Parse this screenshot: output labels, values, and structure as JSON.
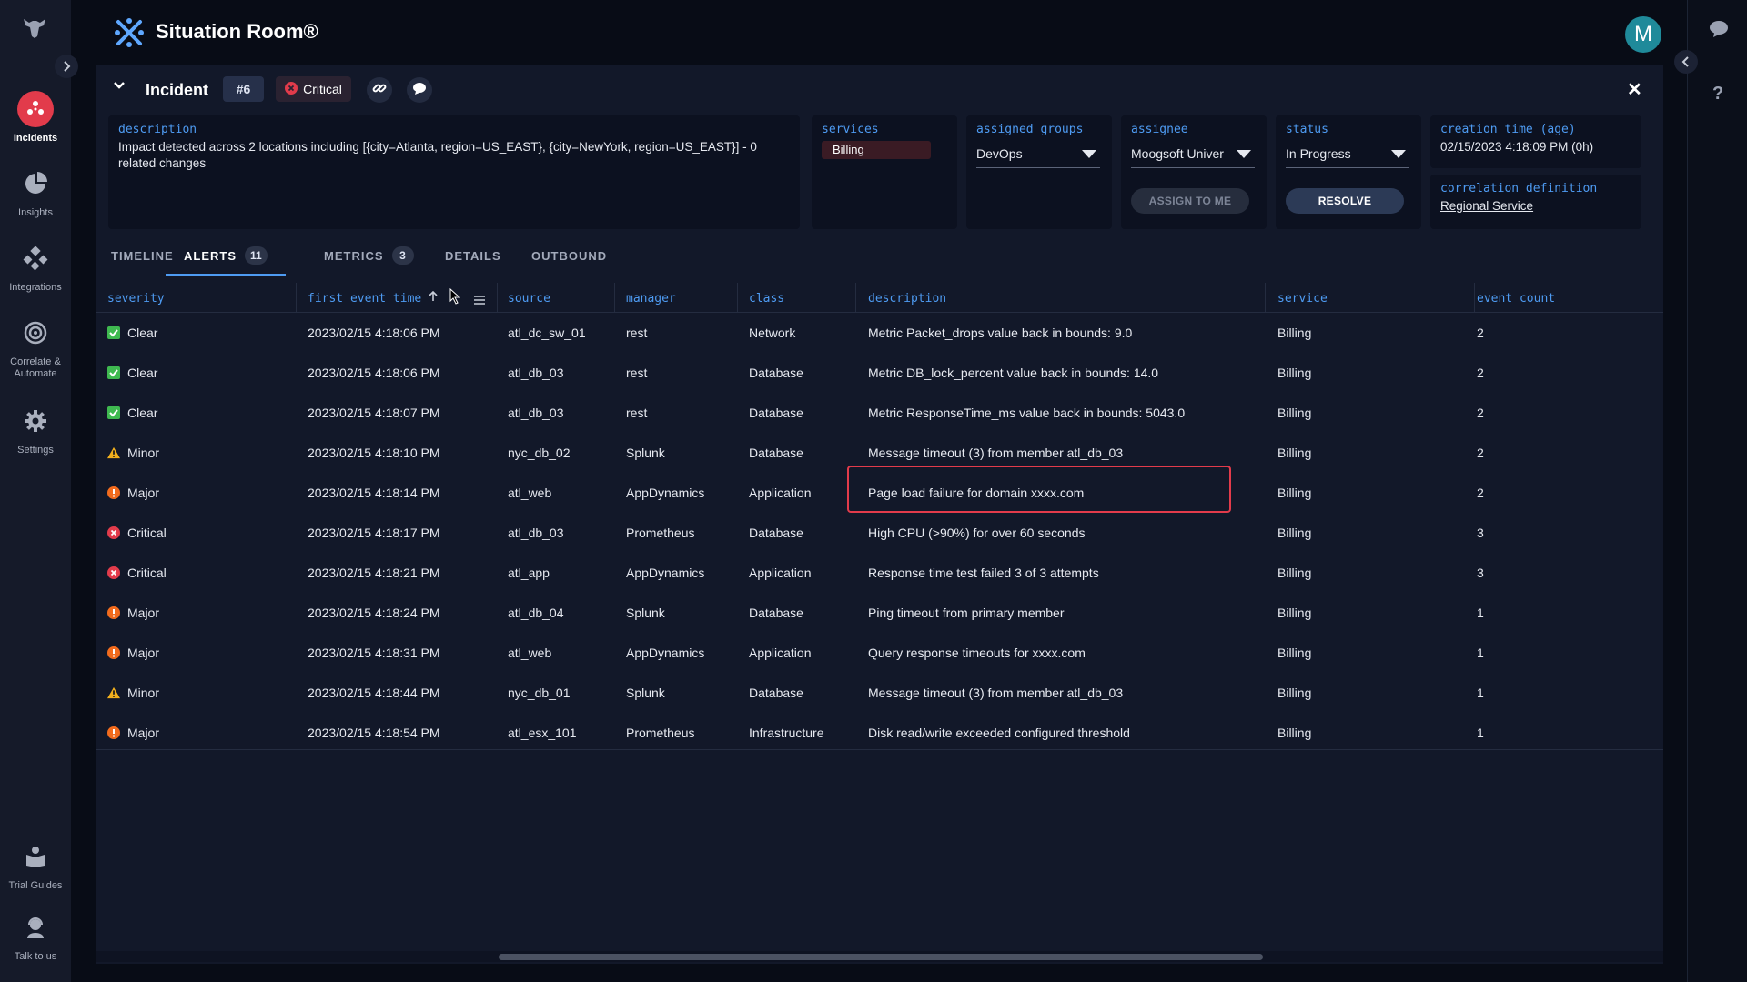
{
  "app": {
    "title": "Situation Room®",
    "user_initial": "M"
  },
  "nav": {
    "items": [
      {
        "label": "Incidents",
        "icon": "incidents-icon"
      },
      {
        "label": "Insights",
        "icon": "pie-chart-icon"
      },
      {
        "label": "Integrations",
        "icon": "integrations-icon"
      },
      {
        "label": "Correlate & Automate",
        "icon": "target-icon"
      },
      {
        "label": "Settings",
        "icon": "gear-icon"
      },
      {
        "label": "Trial Guides",
        "icon": "guide-icon"
      },
      {
        "label": "Talk to us",
        "icon": "support-agent-icon"
      }
    ]
  },
  "incident": {
    "title": "Incident",
    "number": "#6",
    "severity": "Critical",
    "description_label": "description",
    "description": "Impact detected across 2 locations including [{city=Atlanta, region=US_EAST}, {city=NewYork, region=US_EAST}] - 0 related changes",
    "services_label": "services",
    "service": "Billing",
    "assigned_groups_label": "assigned groups",
    "assigned_group": "DevOps",
    "assignee_label": "assignee",
    "assignee": "Moogsoft Univer",
    "assign_to_me": "ASSIGN TO ME",
    "status_label": "status",
    "status": "In Progress",
    "resolve": "RESOLVE",
    "creation_label": "creation time (age)",
    "creation_time": "02/15/2023 4:18:09 PM (0h)",
    "correlation_label": "correlation definition",
    "correlation": "Regional Service"
  },
  "tabs": [
    {
      "label": "TIMELINE",
      "count": ""
    },
    {
      "label": "ALERTS",
      "count": "11"
    },
    {
      "label": "METRICS",
      "count": "3"
    },
    {
      "label": "DETAILS",
      "count": ""
    },
    {
      "label": "OUTBOUND",
      "count": ""
    }
  ],
  "table": {
    "headers": [
      "severity",
      "first event time",
      "source",
      "manager",
      "class",
      "description",
      "service",
      "event count"
    ],
    "rows": [
      {
        "severity": "Clear",
        "time": "2023/02/15 4:18:06 PM",
        "source": "atl_dc_sw_01",
        "manager": "rest",
        "class": "Network",
        "description": "Metric Packet_drops value back in bounds: 9.0",
        "service": "Billing",
        "count": "2"
      },
      {
        "severity": "Clear",
        "time": "2023/02/15 4:18:06 PM",
        "source": "atl_db_03",
        "manager": "rest",
        "class": "Database",
        "description": "Metric DB_lock_percent value back in bounds: 14.0",
        "service": "Billing",
        "count": "2"
      },
      {
        "severity": "Clear",
        "time": "2023/02/15 4:18:07 PM",
        "source": "atl_db_03",
        "manager": "rest",
        "class": "Database",
        "description": "Metric ResponseTime_ms value back in bounds: 5043.0",
        "service": "Billing",
        "count": "2"
      },
      {
        "severity": "Minor",
        "time": "2023/02/15 4:18:10 PM",
        "source": "nyc_db_02",
        "manager": "Splunk",
        "class": "Database",
        "description": "Message timeout (3) from member atl_db_03",
        "service": "Billing",
        "count": "2"
      },
      {
        "severity": "Major",
        "time": "2023/02/15 4:18:14 PM",
        "source": "atl_web",
        "manager": "AppDynamics",
        "class": "Application",
        "description": "Page load failure for domain xxxx.com",
        "service": "Billing",
        "count": "2"
      },
      {
        "severity": "Critical",
        "time": "2023/02/15 4:18:17 PM",
        "source": "atl_db_03",
        "manager": "Prometheus",
        "class": "Database",
        "description": "High CPU (>90%) for over 60 seconds",
        "service": "Billing",
        "count": "3"
      },
      {
        "severity": "Critical",
        "time": "2023/02/15 4:18:21 PM",
        "source": "atl_app",
        "manager": "AppDynamics",
        "class": "Application",
        "description": "Response time test failed 3 of 3 attempts",
        "service": "Billing",
        "count": "3"
      },
      {
        "severity": "Major",
        "time": "2023/02/15 4:18:24 PM",
        "source": "atl_db_04",
        "manager": "Splunk",
        "class": "Database",
        "description": "Ping timeout from primary member",
        "service": "Billing",
        "count": "1"
      },
      {
        "severity": "Major",
        "time": "2023/02/15 4:18:31 PM",
        "source": "atl_web",
        "manager": "AppDynamics",
        "class": "Application",
        "description": "Query response timeouts for xxxx.com",
        "service": "Billing",
        "count": "1"
      },
      {
        "severity": "Minor",
        "time": "2023/02/15 4:18:44 PM",
        "source": "nyc_db_01",
        "manager": "Splunk",
        "class": "Database",
        "description": "Message timeout (3) from member atl_db_03",
        "service": "Billing",
        "count": "1"
      },
      {
        "severity": "Major",
        "time": "2023/02/15 4:18:54 PM",
        "source": "atl_esx_101",
        "manager": "Prometheus",
        "class": "Infrastructure",
        "description": "Disk read/write exceeded configured threshold",
        "service": "Billing",
        "count": "1"
      }
    ]
  },
  "colors": {
    "accent": "#4e9bf2",
    "critical": "#e23b4b",
    "major": "#f26b1d",
    "minor": "#f2b01e",
    "clear": "#3fb950"
  }
}
